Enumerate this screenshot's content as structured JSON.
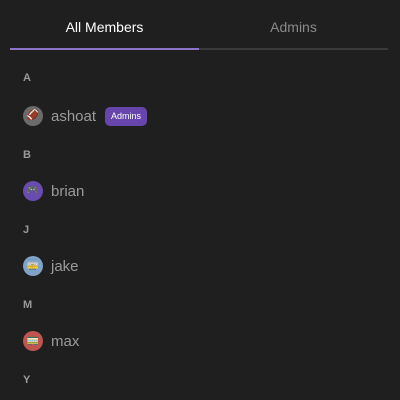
{
  "tabs": [
    {
      "label": "All Members",
      "active": true
    },
    {
      "label": "Admins",
      "active": false
    }
  ],
  "sections": [
    {
      "letter": "A",
      "members": [
        {
          "name": "ashoat",
          "avatar_emoji": "🏈",
          "avatar_color": "#6b6b6b",
          "badge": "Admins"
        }
      ]
    },
    {
      "letter": "B",
      "members": [
        {
          "name": "brian",
          "avatar_emoji": "🎮",
          "avatar_color": "#6a4bb0"
        }
      ]
    },
    {
      "letter": "J",
      "members": [
        {
          "name": "jake",
          "avatar_emoji": "🚋",
          "avatar_color": "#7fa3c9"
        }
      ]
    },
    {
      "letter": "M",
      "members": [
        {
          "name": "max",
          "avatar_emoji": "🚃",
          "avatar_color": "#c0544f"
        }
      ]
    },
    {
      "letter": "Y",
      "members": []
    }
  ],
  "colors": {
    "background": "#1f1f1f",
    "accent": "#8b74c9",
    "badge": "#6645ad"
  }
}
